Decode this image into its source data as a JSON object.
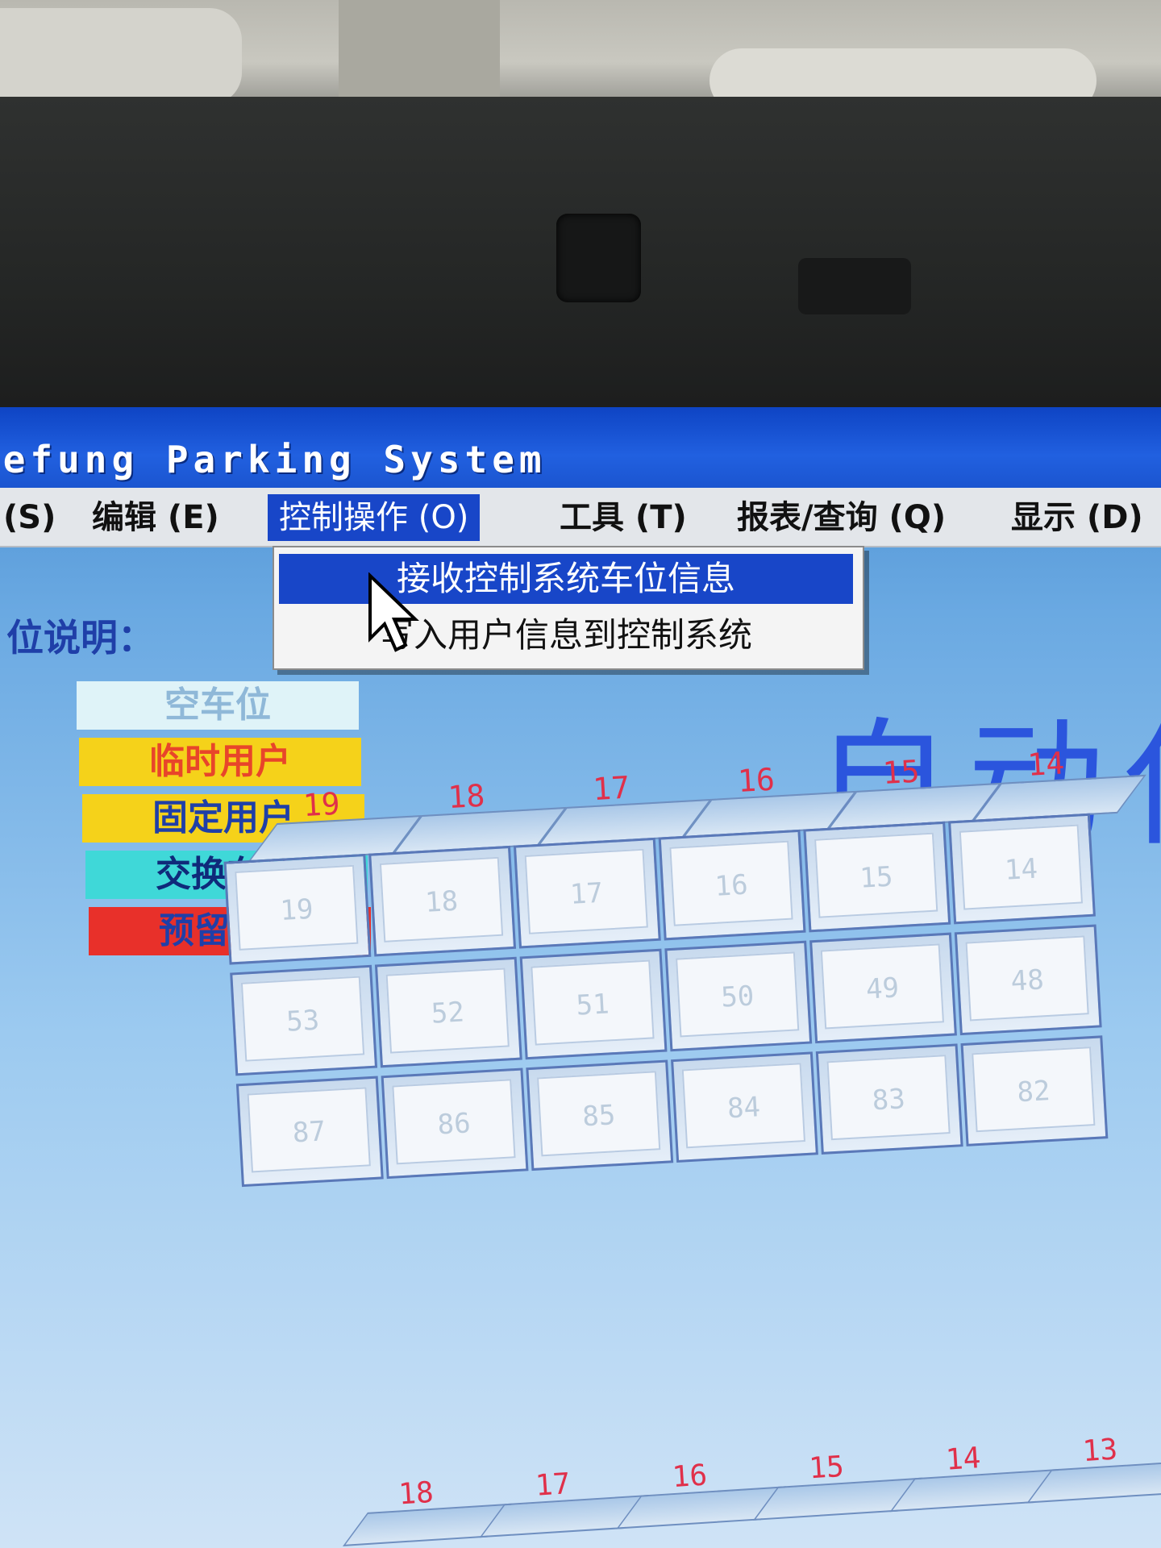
{
  "app_title": "eefung Parking System",
  "menu": [
    {
      "label": "(S)",
      "key": "system"
    },
    {
      "label": "编辑 (E)",
      "key": "edit"
    },
    {
      "label": "控制操作 (O)",
      "key": "control",
      "active": true
    },
    {
      "label": "工具 (T)",
      "key": "tools"
    },
    {
      "label": "报表/查询 (Q)",
      "key": "report"
    },
    {
      "label": "显示 (D)",
      "key": "display"
    }
  ],
  "dropdown": [
    {
      "label": "接收控制系统车位信息",
      "highlighted": true
    },
    {
      "label": "写入用户信息到控制系统"
    }
  ],
  "legend": {
    "title": "位说明：",
    "items": [
      {
        "label": "空车位",
        "bg": "#dff3f8",
        "color": "#8fb8d8"
      },
      {
        "label": "临时用户",
        "bg": "#f5d21a",
        "color": "#e8452a"
      },
      {
        "label": "固定用户",
        "bg": "#f5d21a",
        "color": "#1f3fa8"
      },
      {
        "label": "交换车位",
        "bg": "#3fd8d8",
        "color": "#0f2a7a"
      },
      {
        "label": "预留车位",
        "bg": "#e8302a",
        "color": "#1f3fa8"
      }
    ]
  },
  "main_title": "自动化",
  "grid": {
    "columns": [
      "19",
      "18",
      "17",
      "16",
      "15",
      "14"
    ],
    "rows": [
      [
        "19",
        "18",
        "17",
        "16",
        "15",
        "14"
      ],
      [
        "53",
        "52",
        "51",
        "50",
        "49",
        "48"
      ],
      [
        "87",
        "86",
        "85",
        "84",
        "83",
        "82"
      ]
    ]
  },
  "grid2": {
    "columns": [
      "18",
      "17",
      "16",
      "15",
      "14",
      "13"
    ]
  },
  "colors": {
    "titlebar": "#1b55d0",
    "menu_highlight": "#1846c8",
    "column_label": "#e0304a",
    "main_title": "#2b55dd"
  }
}
